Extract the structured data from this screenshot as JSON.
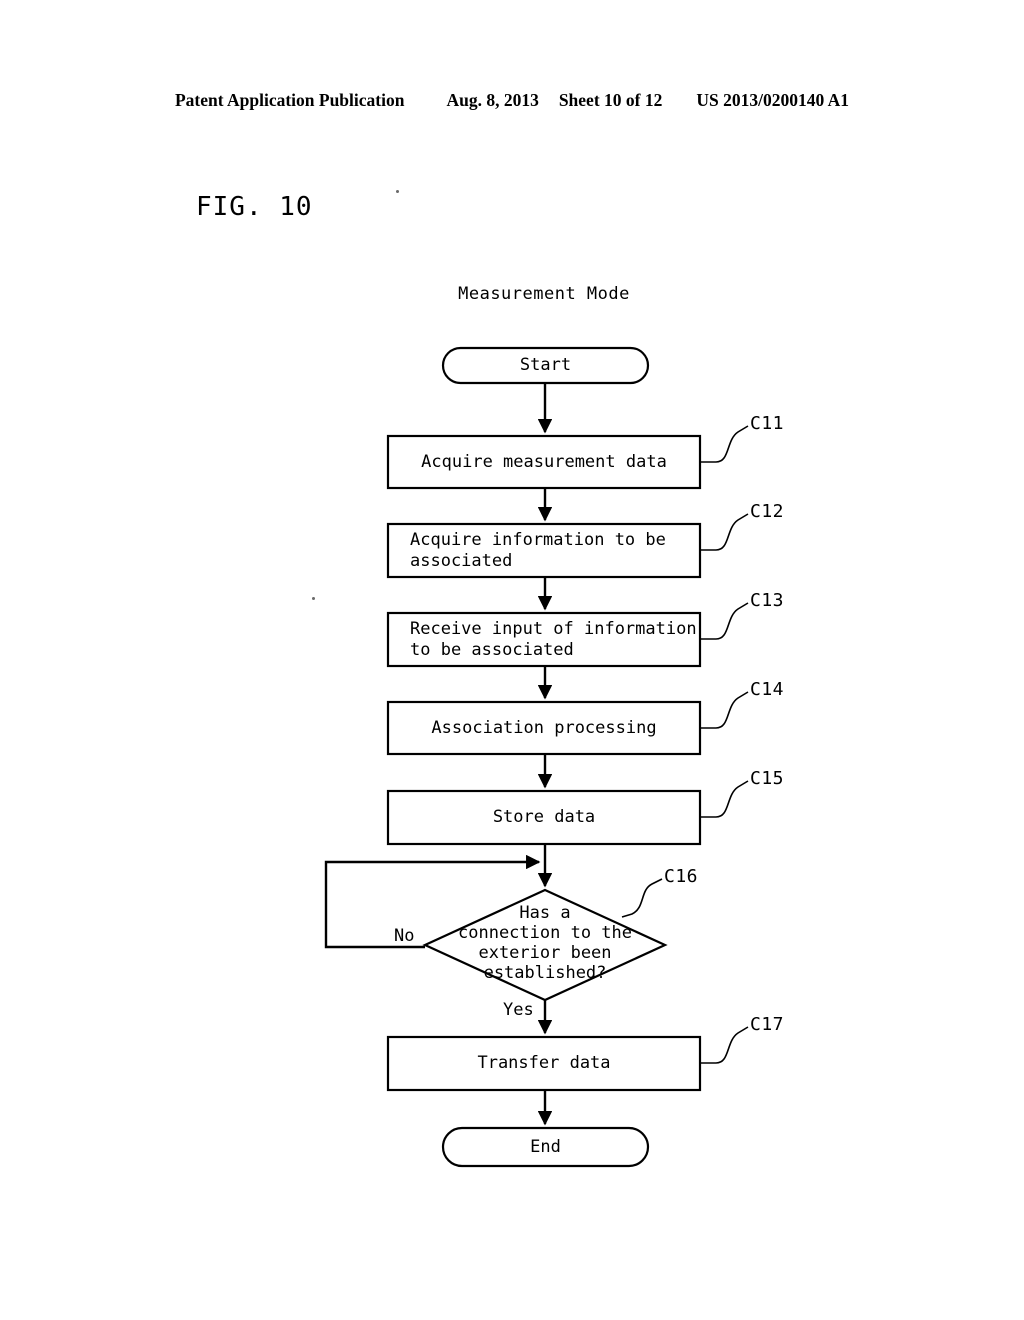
{
  "header": {
    "publication": "Patent Application Publication",
    "date": "Aug. 8, 2013",
    "sheet": "Sheet 10 of 12",
    "patent_number": "US 2013/0200140 A1"
  },
  "figure": {
    "label": "FIG. 10",
    "title": "Measurement Mode"
  },
  "flowchart": {
    "start": {
      "label": "Start"
    },
    "end": {
      "label": "End"
    },
    "steps": [
      {
        "ref": "C11",
        "label": "Acquire measurement data",
        "align": "center"
      },
      {
        "ref": "C12",
        "label": "Acquire information to be\nassociated",
        "align": "left"
      },
      {
        "ref": "C13",
        "label": "Receive input of information\nto be associated",
        "align": "left"
      },
      {
        "ref": "C14",
        "label": "Association processing",
        "align": "center"
      },
      {
        "ref": "C15",
        "label": "Store data",
        "align": "center"
      },
      {
        "ref": "C17",
        "label": "Transfer data",
        "align": "center"
      }
    ],
    "decision": {
      "ref": "C16",
      "line1": "Has a",
      "line2": "connection to the",
      "line3": "exterior been",
      "line4": "established?",
      "branch_no": "No",
      "branch_yes": "Yes"
    }
  },
  "colors": {
    "ink": "#000000",
    "paper": "#ffffff"
  }
}
